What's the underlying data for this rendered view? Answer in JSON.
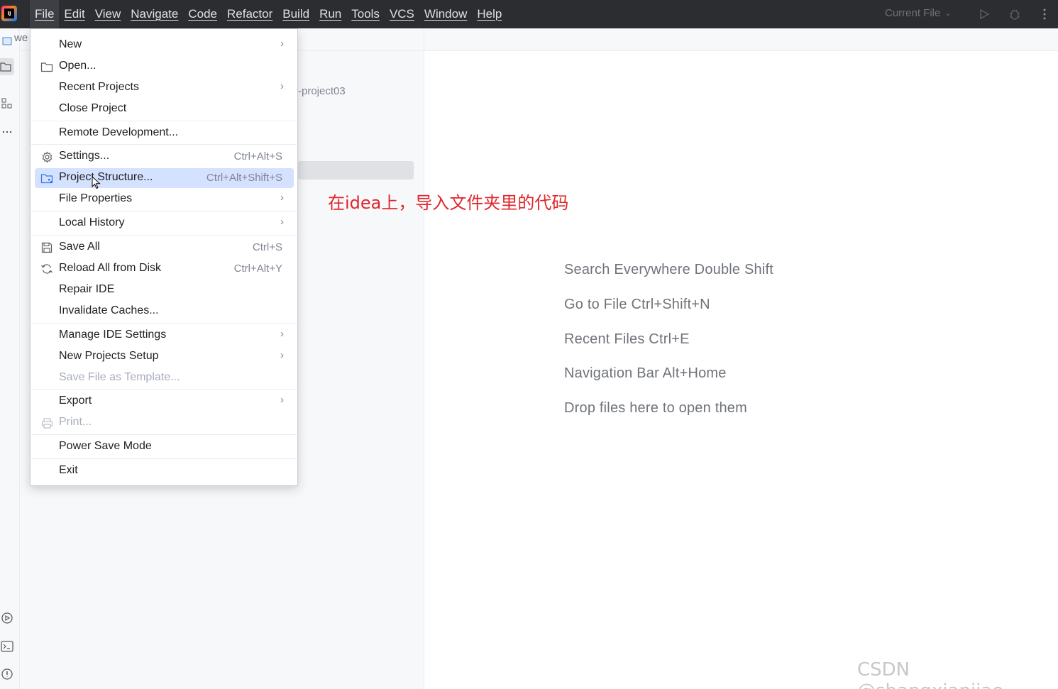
{
  "menubar": {
    "items": [
      "File",
      "Edit",
      "View",
      "Navigate",
      "Code",
      "Refactor",
      "Build",
      "Run",
      "Tools",
      "VCS",
      "Window",
      "Help"
    ],
    "current_file": "Current File"
  },
  "project_panel": {
    "tab_label": "we",
    "path_fragment": "-project03"
  },
  "file_menu": {
    "new": "New",
    "open": "Open...",
    "recent_projects": "Recent Projects",
    "close_project": "Close Project",
    "remote_development": "Remote Development...",
    "settings": "Settings...",
    "settings_shortcut": "Ctrl+Alt+S",
    "project_structure": "Project Structure...",
    "project_structure_shortcut": "Ctrl+Alt+Shift+S",
    "file_properties": "File Properties",
    "local_history": "Local History",
    "save_all": "Save All",
    "save_all_shortcut": "Ctrl+S",
    "reload_all": "Reload All from Disk",
    "reload_all_shortcut": "Ctrl+Alt+Y",
    "repair_ide": "Repair IDE",
    "invalidate_caches": "Invalidate Caches...",
    "manage_ide_settings": "Manage IDE Settings",
    "new_projects_setup": "New Projects Setup",
    "save_file_as_template": "Save File as Template...",
    "export": "Export",
    "print": "Print...",
    "power_save_mode": "Power Save Mode",
    "exit": "Exit"
  },
  "editor": {
    "hints": [
      "Search Everywhere Double Shift",
      "Go to File Ctrl+Shift+N",
      "Recent Files Ctrl+E",
      "Navigation Bar Alt+Home",
      "Drop files here to open them"
    ]
  },
  "annotation": "在idea上，导入文件夹里的代码",
  "watermark": "CSDN @shangxianjiao"
}
